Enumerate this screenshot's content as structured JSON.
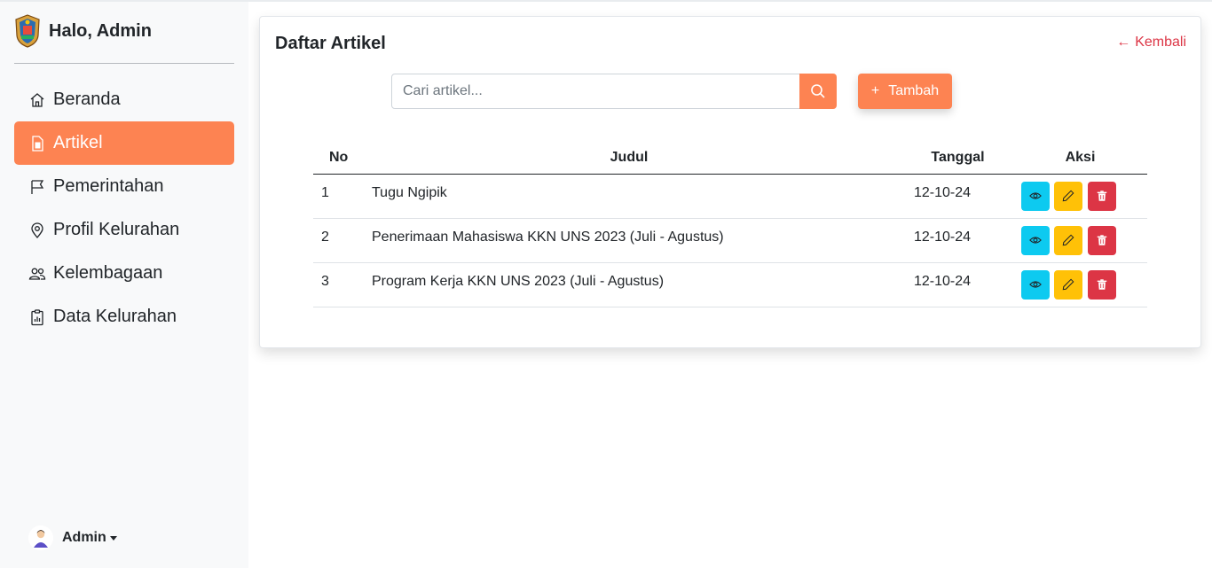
{
  "sidebar": {
    "greeting": "Halo, Admin",
    "items": [
      {
        "label": "Beranda",
        "icon": "house-icon"
      },
      {
        "label": "Artikel",
        "icon": "file-icon",
        "active": true
      },
      {
        "label": "Pemerintahan",
        "icon": "flag-icon"
      },
      {
        "label": "Profil Kelurahan",
        "icon": "location-pin-icon"
      },
      {
        "label": "Kelembagaan",
        "icon": "people-icon"
      },
      {
        "label": "Data Kelurahan",
        "icon": "clipboard-data-icon"
      }
    ],
    "user": "Admin"
  },
  "main": {
    "title": "Daftar Artikel",
    "back_label": "Kembali",
    "search_placeholder": "Cari artikel...",
    "add_label": "Tambah",
    "columns": {
      "no": "No",
      "judul": "Judul",
      "tanggal": "Tanggal",
      "aksi": "Aksi"
    },
    "rows": [
      {
        "no": "1",
        "judul": "Tugu Ngipik",
        "tanggal": "12-10-24"
      },
      {
        "no": "2",
        "judul": "Penerimaan Mahasiswa KKN UNS 2023 (Juli - Agustus)",
        "tanggal": "12-10-24"
      },
      {
        "no": "3",
        "judul": "Program Kerja KKN UNS 2023 (Juli - Agustus)",
        "tanggal": "12-10-24"
      }
    ]
  },
  "colors": {
    "accent": "#fd8352",
    "view": "#0dcaf0",
    "edit": "#ffc107",
    "delete": "#dc3545",
    "link": "#dc3545"
  }
}
